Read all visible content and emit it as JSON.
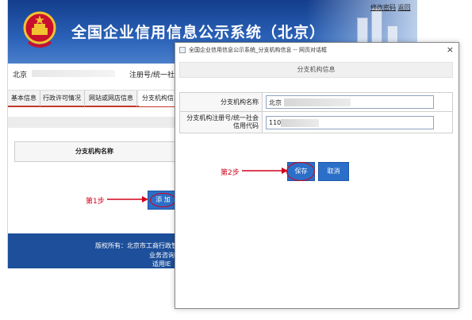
{
  "site": {
    "title": "全国企业信用信息公示系统（北京）",
    "top_links": [
      "修改密码",
      "返回"
    ]
  },
  "info_row": {
    "region": "北京",
    "code_label": "注册号/统一社"
  },
  "tabs": [
    "基本信息",
    "行政许可情况",
    "网站或网店信息",
    "分支机构信"
  ],
  "active_tab": 3,
  "bg_table": {
    "header": "分支机构名称"
  },
  "step1": {
    "label": "第1步",
    "button": "添 加"
  },
  "footer": {
    "line1": "版权所有：北京市工商行政管理",
    "line2": "业务咨询",
    "line3": "适用IE"
  },
  "modal": {
    "window_title": "全国企业信用信息公示系统_分支机构信息 -- 网页对话框",
    "close_glyph": "×",
    "header": "分支机构信息",
    "fields": [
      {
        "label": "分支机构名称",
        "value": "北京"
      },
      {
        "label": "分支机构注册号/统一社会信用代码",
        "value": "110"
      }
    ],
    "step2_label": "第2步",
    "save_label": "保存",
    "cancel_label": "取消"
  },
  "colors": {
    "banner": "#2a62b8",
    "button": "#2c6fc8",
    "annotation": "#d0021b",
    "tab_underline": "#c0392b"
  },
  "icons": [
    "national-emblem-icon",
    "close-icon",
    "page-favicon-icon",
    "arrow-right-icon"
  ]
}
